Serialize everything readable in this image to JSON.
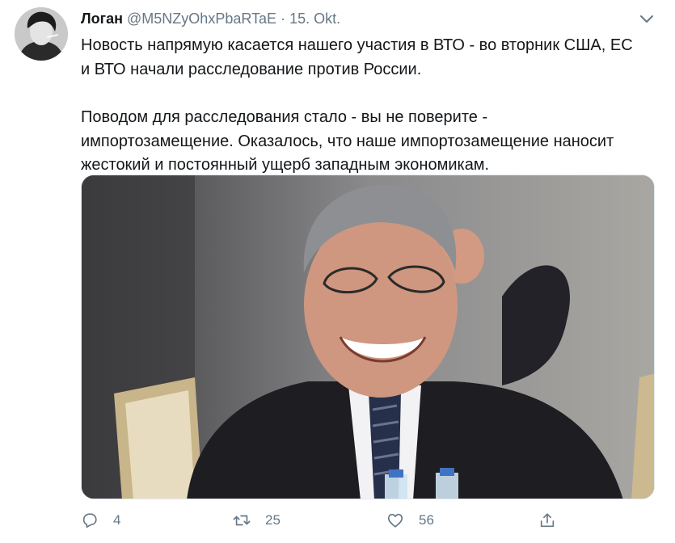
{
  "tweet": {
    "author_name": "Логан",
    "handle": "@M5NZyOhxPbaRTaE",
    "separator": "·",
    "date": "15. Okt.",
    "paragraphs": [
      "Новость напрямую касается нашего участия в ВТО - во вторник США, ЕС\nи ВТО начали расследование против России.",
      "Поводом для расследования стало - вы не поверите -\nимпортозамещение. Оказалось, что наше импортозамещение наносит\nжестокий и постоянный ущерб западным экономикам."
    ]
  },
  "actions": {
    "reply_count": "4",
    "retweet_count": "25",
    "like_count": "56"
  },
  "icons": [
    "chevron-down-icon",
    "reply-icon",
    "retweet-icon",
    "like-icon",
    "share-icon"
  ],
  "colors": {
    "text": "#14171a",
    "secondary": "#657786",
    "border": "#e1e8ed"
  }
}
